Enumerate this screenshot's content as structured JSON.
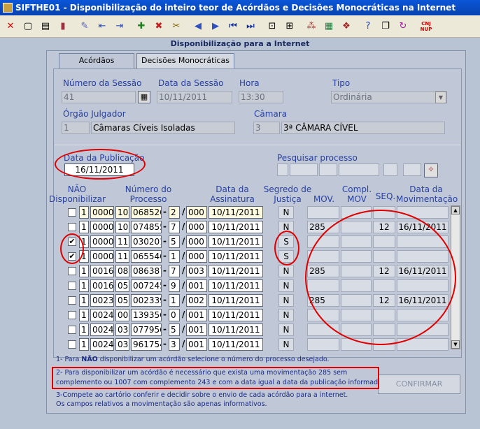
{
  "window": {
    "title": "SIFTHE01 - Disponibilização do inteiro teor de Acórdãos e Decisões Monocráticas na Internet"
  },
  "toolbar": {
    "icons": [
      "close-icon",
      "blank-page-icon",
      "print-icon",
      "exit-door-icon",
      "clear-icon",
      "prev-block-icon",
      "next-block-icon",
      "insert-record-icon",
      "delete-record-icon",
      "lock-record-icon",
      "prev-record-icon",
      "next-record-icon",
      "first-record-icon",
      "last-record-icon",
      "query-icon",
      "execute-query-icon",
      "list-values-icon",
      "calculator-icon",
      "keys-icon",
      "help-icon",
      "copy-icon",
      "refresh-icon",
      "cnj-nup-icon"
    ],
    "cnj_label": "CNJ NUP"
  },
  "panel": {
    "title": "Disponibilização para a Internet"
  },
  "tabs": [
    {
      "label": "Acórdãos",
      "active": true
    },
    {
      "label": "Decisões Monocráticas",
      "active": false
    }
  ],
  "form": {
    "numero_sessao": {
      "label": "Número da Sessão",
      "value": "41"
    },
    "data_sessao": {
      "label": "Data da Sessão",
      "value": "10/11/2011"
    },
    "hora": {
      "label": "Hora",
      "value": "13:30"
    },
    "tipo": {
      "label": "Tipo",
      "value": "Ordinária"
    },
    "orgao_julgador": {
      "label": "Órgão Julgador",
      "code": "1",
      "name": "Câmaras Cíveis Isoladas"
    },
    "camara": {
      "label": "Câmara",
      "code": "3",
      "name": "3ª CÂMARA CÍVEL"
    },
    "data_publicacao": {
      "label": "Data da Publicação",
      "value": "16/11/2011"
    },
    "pesquisar": {
      "label": "Pesquisar  processo"
    }
  },
  "table": {
    "headers": {
      "nao_disp": "NÃO\nDisponibilizar",
      "numero": "Número do\nProcesso",
      "data_assinatura": "Data da\nAssinatura",
      "segredo": "Segredo de\nJustiça",
      "mov": "MOV.",
      "compl": "Compl.\nMOV",
      "seq": "SEQ.",
      "data_mov": "Data da\nMovimentação"
    },
    "rows": [
      {
        "checked": false,
        "p1": "1",
        "p2": "0000",
        "p3": "10",
        "p4": "068526",
        "p5": "2",
        "p6": "000",
        "assinatura": "10/11/2011",
        "segredo": "N",
        "mov": "",
        "compl": "",
        "seq": "",
        "data_mov": "",
        "highlight": true
      },
      {
        "checked": false,
        "p1": "1",
        "p2": "0000",
        "p3": "10",
        "p4": "074855",
        "p5": "7",
        "p6": "000",
        "assinatura": "10/11/2011",
        "segredo": "N",
        "mov": "285",
        "compl": "",
        "seq": "12",
        "data_mov": "16/11/2011"
      },
      {
        "checked": true,
        "p1": "1",
        "p2": "0000",
        "p3": "11",
        "p4": "030201",
        "p5": "5",
        "p6": "000",
        "assinatura": "10/11/2011",
        "segredo": "S",
        "mov": "",
        "compl": "",
        "seq": "",
        "data_mov": ""
      },
      {
        "checked": true,
        "p1": "1",
        "p2": "0000",
        "p3": "11",
        "p4": "065546",
        "p5": "1",
        "p6": "000",
        "assinatura": "10/11/2011",
        "segredo": "S",
        "mov": "",
        "compl": "",
        "seq": "",
        "data_mov": ""
      },
      {
        "checked": false,
        "p1": "1",
        "p2": "0016",
        "p3": "08",
        "p4": "086387",
        "p5": "7",
        "p6": "003",
        "assinatura": "10/11/2011",
        "segredo": "N",
        "mov": "285",
        "compl": "",
        "seq": "12",
        "data_mov": "16/11/2011"
      },
      {
        "checked": false,
        "p1": "1",
        "p2": "0016",
        "p3": "05",
        "p4": "007245",
        "p5": "9",
        "p6": "001",
        "assinatura": "10/11/2011",
        "segredo": "N",
        "mov": "",
        "compl": "",
        "seq": "",
        "data_mov": ""
      },
      {
        "checked": false,
        "p1": "1",
        "p2": "0023",
        "p3": "05",
        "p4": "002339",
        "p5": "1",
        "p6": "002",
        "assinatura": "10/11/2011",
        "segredo": "N",
        "mov": "285",
        "compl": "",
        "seq": "12",
        "data_mov": "16/11/2011"
      },
      {
        "checked": false,
        "p1": "1",
        "p2": "0024",
        "p3": "00",
        "p4": "139356",
        "p5": "0",
        "p6": "001",
        "assinatura": "10/11/2011",
        "segredo": "N",
        "mov": "",
        "compl": "",
        "seq": "",
        "data_mov": ""
      },
      {
        "checked": false,
        "p1": "1",
        "p2": "0024",
        "p3": "03",
        "p4": "077956",
        "p5": "5",
        "p6": "001",
        "assinatura": "10/11/2011",
        "segredo": "N",
        "mov": "",
        "compl": "",
        "seq": "",
        "data_mov": ""
      },
      {
        "checked": false,
        "p1": "1",
        "p2": "0024",
        "p3": "03",
        "p4": "961754",
        "p5": "3",
        "p6": "001",
        "assinatura": "10/11/2011",
        "segredo": "N",
        "mov": "",
        "compl": "",
        "seq": "",
        "data_mov": ""
      }
    ]
  },
  "notes": {
    "n1_pre": "1- Para ",
    "n1_bold": "NÃO",
    "n1_post": " disponibilizar um acórdão selecione o número do processo desejado.",
    "n2_line1": "2- Para disponibilizar um acórdão é necessário que exista uma movimentação 285 sem",
    "n2_line2": "complemento ou 1007 com complemento 243 e com a data igual a data da publicação informada.",
    "n3_line1": "3-Compete ao cartório conferir e decidir sobre o envio de cada acórdão para a internet.",
    "n3_line2": "Os campos relativos a movimentação são apenas informativos."
  },
  "buttons": {
    "confirmar": "CONFIRMAR"
  },
  "colors": {
    "annotation": "#e00000",
    "label": "#2840a0",
    "titlebar": "#0a56d8"
  }
}
